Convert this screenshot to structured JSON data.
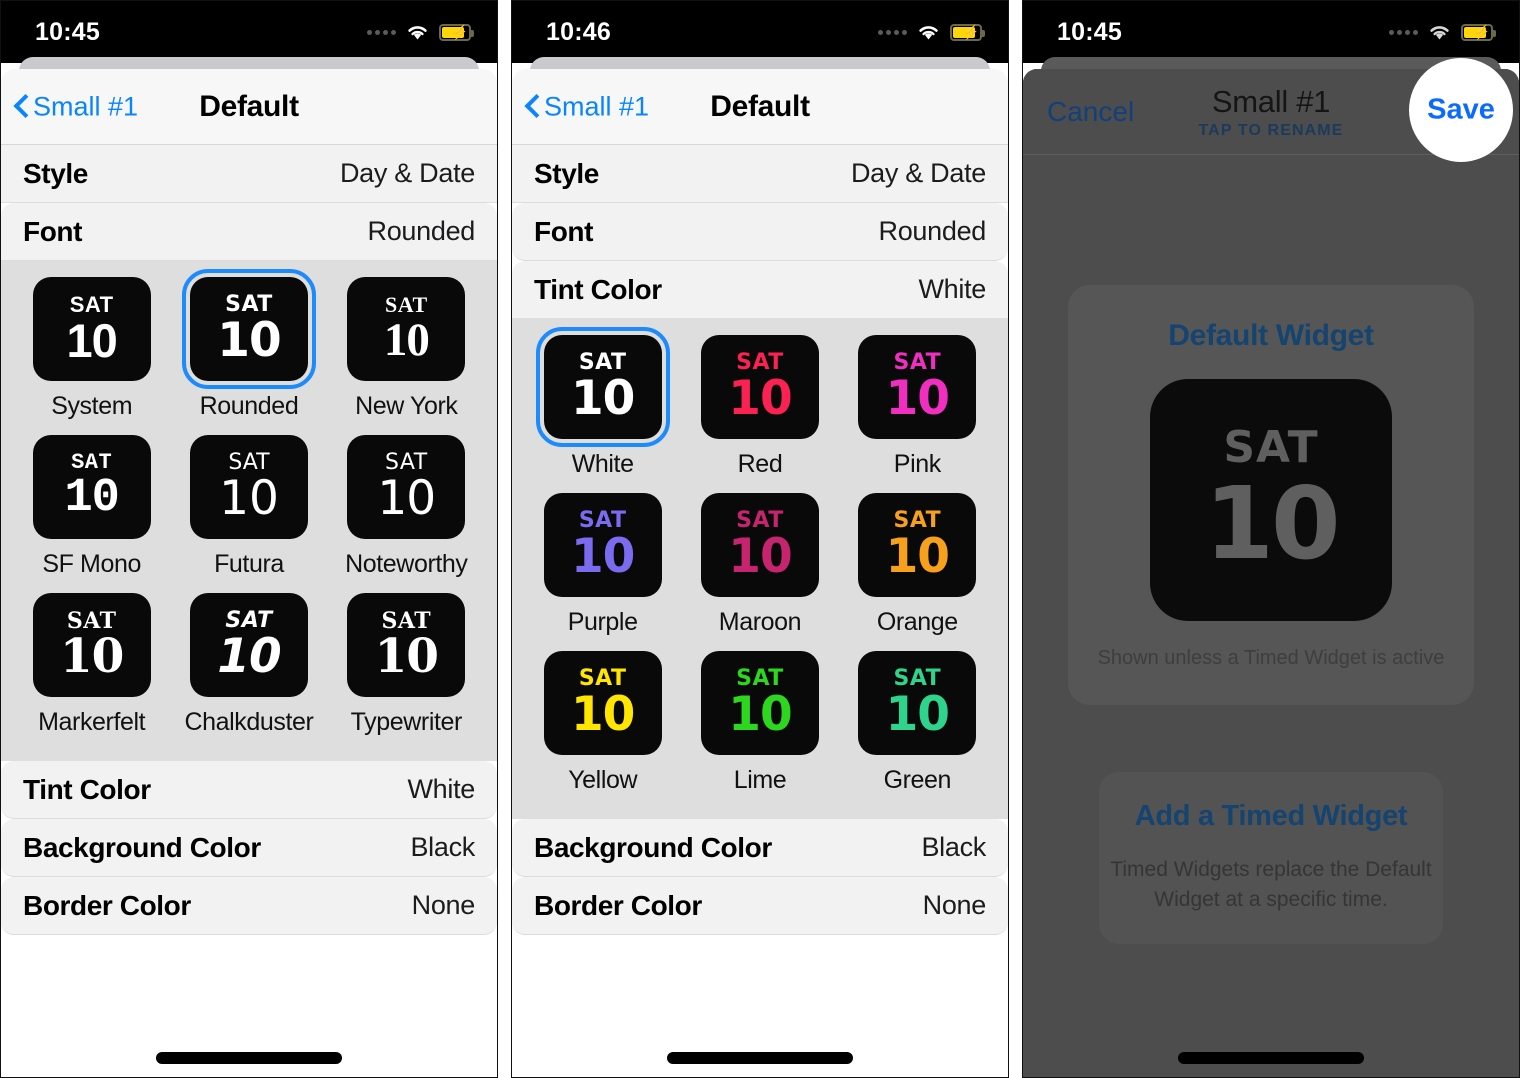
{
  "panels": [
    {
      "id": "font-picker",
      "status": {
        "time": "10:45",
        "signal_icon": "signal-dots-icon",
        "wifi_icon": "wifi-icon",
        "battery_icon": "battery-charging-icon"
      },
      "nav": {
        "back_label": "Small #1",
        "title": "Default"
      },
      "rows_top": [
        {
          "label": "Style",
          "value": "Day & Date"
        },
        {
          "label": "Font",
          "value": "Rounded"
        }
      ],
      "grid_title": "Font",
      "options": [
        {
          "label": "System",
          "dow": "SAT",
          "day": "10",
          "tint": "#FFFFFF",
          "selected": false,
          "font_class": "f-system"
        },
        {
          "label": "Rounded",
          "dow": "SAT",
          "day": "10",
          "tint": "#FFFFFF",
          "selected": true,
          "font_class": "f-rounded"
        },
        {
          "label": "New York",
          "dow": "SAT",
          "day": "10",
          "tint": "#FFFFFF",
          "selected": false,
          "font_class": "f-newyork"
        },
        {
          "label": "SF Mono",
          "dow": "SAT",
          "day": "10",
          "tint": "#FFFFFF",
          "selected": false,
          "font_class": "f-sfmono"
        },
        {
          "label": "Futura",
          "dow": "SAT",
          "day": "10",
          "tint": "#FFFFFF",
          "selected": false,
          "font_class": "f-futura"
        },
        {
          "label": "Noteworthy",
          "dow": "SAT",
          "day": "10",
          "tint": "#FFFFFF",
          "selected": false,
          "font_class": "f-noteworthy"
        },
        {
          "label": "Markerfelt",
          "dow": "SAT",
          "day": "10",
          "tint": "#FFFFFF",
          "selected": false,
          "font_class": "f-markerfelt"
        },
        {
          "label": "Chalkduster",
          "dow": "SAT",
          "day": "10",
          "tint": "#FFFFFF",
          "selected": false,
          "font_class": "f-chalkduster"
        },
        {
          "label": "Typewriter",
          "dow": "SAT",
          "day": "10",
          "tint": "#FFFFFF",
          "selected": false,
          "font_class": "f-typewriter"
        }
      ],
      "rows_bottom": [
        {
          "label": "Tint Color",
          "value": "White"
        },
        {
          "label": "Background Color",
          "value": "Black"
        },
        {
          "label": "Border Color",
          "value": "None"
        }
      ]
    },
    {
      "id": "tint-picker",
      "status": {
        "time": "10:46",
        "signal_icon": "signal-dots-icon",
        "wifi_icon": "wifi-icon",
        "battery_icon": "battery-charging-icon"
      },
      "nav": {
        "back_label": "Small #1",
        "title": "Default"
      },
      "rows_top": [
        {
          "label": "Style",
          "value": "Day & Date"
        },
        {
          "label": "Font",
          "value": "Rounded"
        },
        {
          "label": "Tint Color",
          "value": "White"
        }
      ],
      "grid_title": "Tint Color",
      "options": [
        {
          "label": "White",
          "dow": "SAT",
          "day": "10",
          "tint": "#FFFFFF",
          "selected": true,
          "font_class": "f-rounded"
        },
        {
          "label": "Red",
          "dow": "SAT",
          "day": "10",
          "tint": "#FB2253",
          "selected": false,
          "font_class": "f-rounded"
        },
        {
          "label": "Pink",
          "dow": "SAT",
          "day": "10",
          "tint": "#F02FC0",
          "selected": false,
          "font_class": "f-rounded"
        },
        {
          "label": "Purple",
          "dow": "SAT",
          "day": "10",
          "tint": "#7B6BF0",
          "selected": false,
          "font_class": "f-rounded"
        },
        {
          "label": "Maroon",
          "dow": "SAT",
          "day": "10",
          "tint": "#C72470",
          "selected": false,
          "font_class": "f-rounded"
        },
        {
          "label": "Orange",
          "dow": "SAT",
          "day": "10",
          "tint": "#F6A01C",
          "selected": false,
          "font_class": "f-rounded"
        },
        {
          "label": "Yellow",
          "dow": "SAT",
          "day": "10",
          "tint": "#FFE500",
          "selected": false,
          "font_class": "f-rounded"
        },
        {
          "label": "Lime",
          "dow": "SAT",
          "day": "10",
          "tint": "#2DD61F",
          "selected": false,
          "font_class": "f-rounded"
        },
        {
          "label": "Green",
          "dow": "SAT",
          "day": "10",
          "tint": "#2FD48C",
          "selected": false,
          "font_class": "f-rounded"
        }
      ],
      "rows_bottom": [
        {
          "label": "Background Color",
          "value": "Black"
        },
        {
          "label": "Border Color",
          "value": "None"
        }
      ]
    }
  ],
  "panel3": {
    "id": "widget-editor",
    "status": {
      "time": "10:45",
      "signal_icon": "signal-dots-icon",
      "wifi_icon": "wifi-icon",
      "battery_icon": "battery-charging-icon"
    },
    "nav": {
      "cancel_label": "Cancel",
      "title": "Small #1",
      "subtitle": "TAP TO RENAME",
      "save_label": "Save"
    },
    "default_card": {
      "title": "Default Widget",
      "preview": {
        "dow": "SAT",
        "day": "10"
      },
      "caption": "Shown unless a Timed Widget is active"
    },
    "timed_card": {
      "title": "Add a Timed Widget",
      "subtitle": "Timed Widgets replace the Default Widget at a specific time."
    },
    "highlight": {
      "target": "save-button",
      "shape": "circle"
    }
  },
  "colors": {
    "accent_blue": "#0A84FF",
    "selection_ring": "#1E8BFD",
    "tile_background": "#090909",
    "grid_background": "#DEDEDE",
    "row_background": "#F2F2F2",
    "dim_overlay": "#4D4D4D"
  }
}
